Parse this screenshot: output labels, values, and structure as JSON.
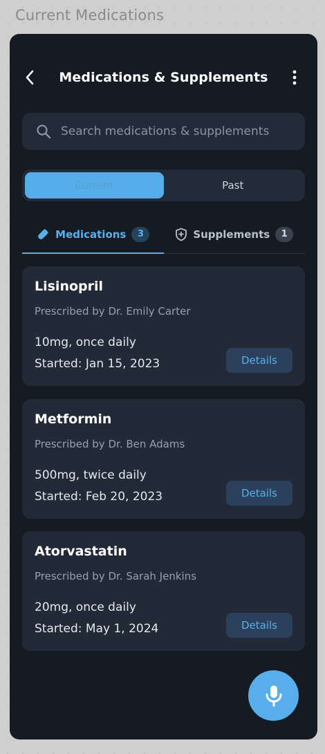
{
  "page_label": "Current Medications",
  "header": {
    "title": "Medications & Supplements",
    "back_icon": "chevron-left-icon",
    "more_icon": "more-vertical-icon"
  },
  "search": {
    "placeholder": "Search medications & supplements",
    "icon": "search-icon"
  },
  "segments": {
    "current": "Current",
    "past": "Past",
    "selected": "current"
  },
  "tabs": {
    "medications": {
      "label": "Medications",
      "count": "3",
      "icon": "pill-icon"
    },
    "supplements": {
      "label": "Supplements",
      "count": "1",
      "icon": "shield-plus-icon"
    },
    "selected": "medications"
  },
  "medications": [
    {
      "name": "Lisinopril",
      "prescriber": "Prescribed by Dr. Emily Carter",
      "dosage": "10mg, once daily",
      "started": "Started: Jan 15, 2023",
      "action": "Details"
    },
    {
      "name": "Metformin",
      "prescriber": "Prescribed by Dr. Ben Adams",
      "dosage": "500mg, twice daily",
      "started": "Started: Feb 20, 2023",
      "action": "Details"
    },
    {
      "name": "Atorvastatin",
      "prescriber": "Prescribed by Dr. Sarah Jenkins",
      "dosage": "20mg, once daily",
      "started": "Started: May 1, 2024",
      "action": "Details"
    }
  ],
  "fab": {
    "icon": "microphone-icon"
  },
  "colors": {
    "accent": "#58b0ee",
    "background": "#151b22",
    "card": "#232a37"
  }
}
